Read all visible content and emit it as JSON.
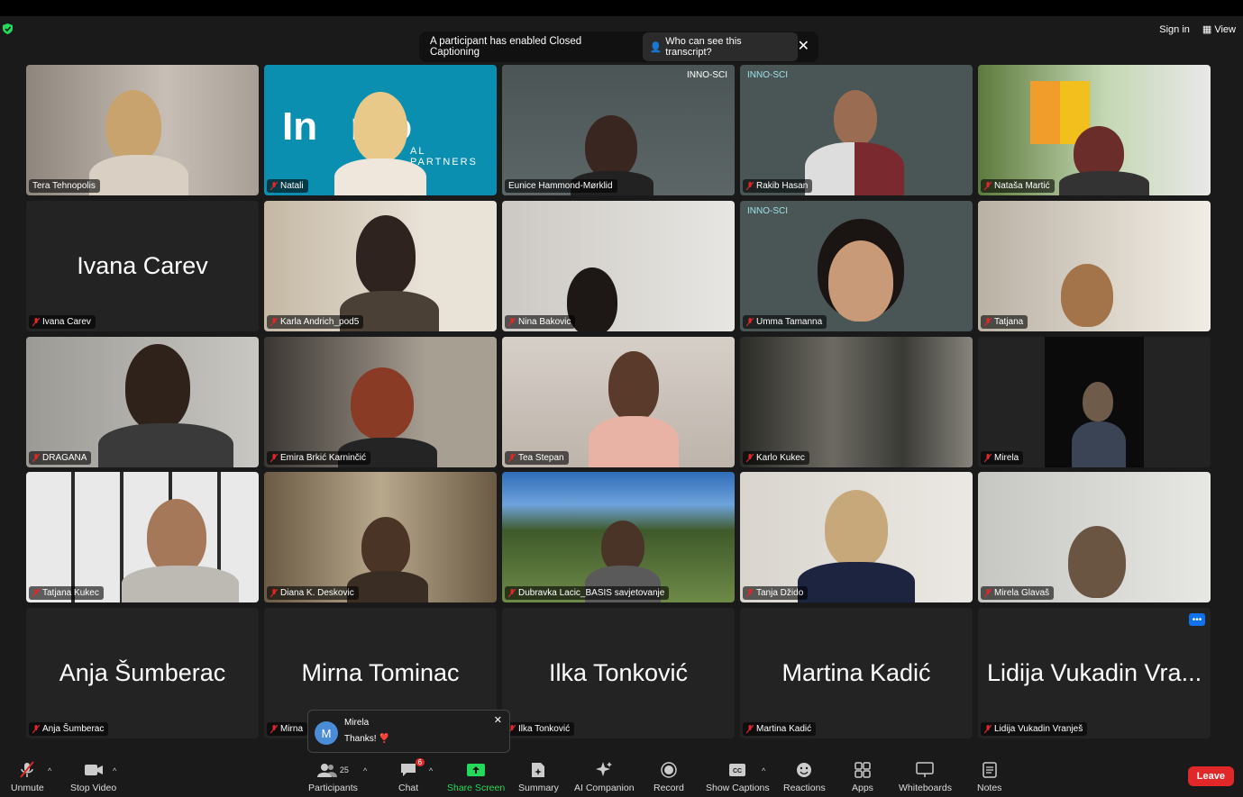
{
  "top": {
    "sign_in": "Sign in",
    "view": "View"
  },
  "banner": {
    "message": "A participant has enabled Closed Captioning",
    "who_button": "Who can see this transcript?"
  },
  "tiles": [
    {
      "name": "Tera Tehnopolis"
    },
    {
      "name": "Natali",
      "logo_text": "In   nto",
      "logo_sub": "AL PARTNERS"
    },
    {
      "name": "Eunice Hammond-Mørklid",
      "logo_text": "INNO-SCI"
    },
    {
      "name": "Rakib Hasan",
      "logo_text": "INNO-SCI"
    },
    {
      "name": "Nataša Martić"
    },
    {
      "name": "Ivana Carev",
      "big": "Ivana Carev"
    },
    {
      "name": "Karla Andrich_pod5"
    },
    {
      "name": "Nina Bakovic"
    },
    {
      "name": "Umma Tamanna",
      "logo_text": "INNO-SCI"
    },
    {
      "name": "Tatjana"
    },
    {
      "name": "DRAGANA"
    },
    {
      "name": "Emira Brkić Karninčić"
    },
    {
      "name": "Tea Stepan"
    },
    {
      "name": "Karlo Kukec"
    },
    {
      "name": "Mirela"
    },
    {
      "name": "Tatjana Kukec"
    },
    {
      "name": "Diana K. Deskovic"
    },
    {
      "name": "Dubravka Lacic_BASIS savjetovanje"
    },
    {
      "name": "Tanja Džido"
    },
    {
      "name": "Mirela Glavaš"
    },
    {
      "name": "Anja Šumberac",
      "big": "Anja Šumberac"
    },
    {
      "name": "Mirna",
      "big": "Mirna Tominac"
    },
    {
      "name": "Ilka Tonković",
      "big": "Ilka Tonković"
    },
    {
      "name": "Martina Kadić",
      "big": "Martina Kadić"
    },
    {
      "name": "Lidija Vukadin Vranješ",
      "big": "Lidija Vukadin Vra..."
    }
  ],
  "chat_popup": {
    "avatar_letter": "M",
    "sender": "Mirela",
    "message": "Thanks! ❣️"
  },
  "toolbar": {
    "unmute": "Unmute",
    "stop_video": "Stop Video",
    "participants": "Participants",
    "participants_count": "25",
    "chat": "Chat",
    "chat_badge": "6",
    "share_screen": "Share Screen",
    "summary": "Summary",
    "ai_companion": "AI Companion",
    "record": "Record",
    "show_captions": "Show Captions",
    "reactions": "Reactions",
    "apps": "Apps",
    "whiteboards": "Whiteboards",
    "notes": "Notes",
    "leave": "Leave"
  },
  "colors": {
    "active_speaker": "#23d959",
    "leave": "#e02828",
    "muted": "#e02828"
  }
}
